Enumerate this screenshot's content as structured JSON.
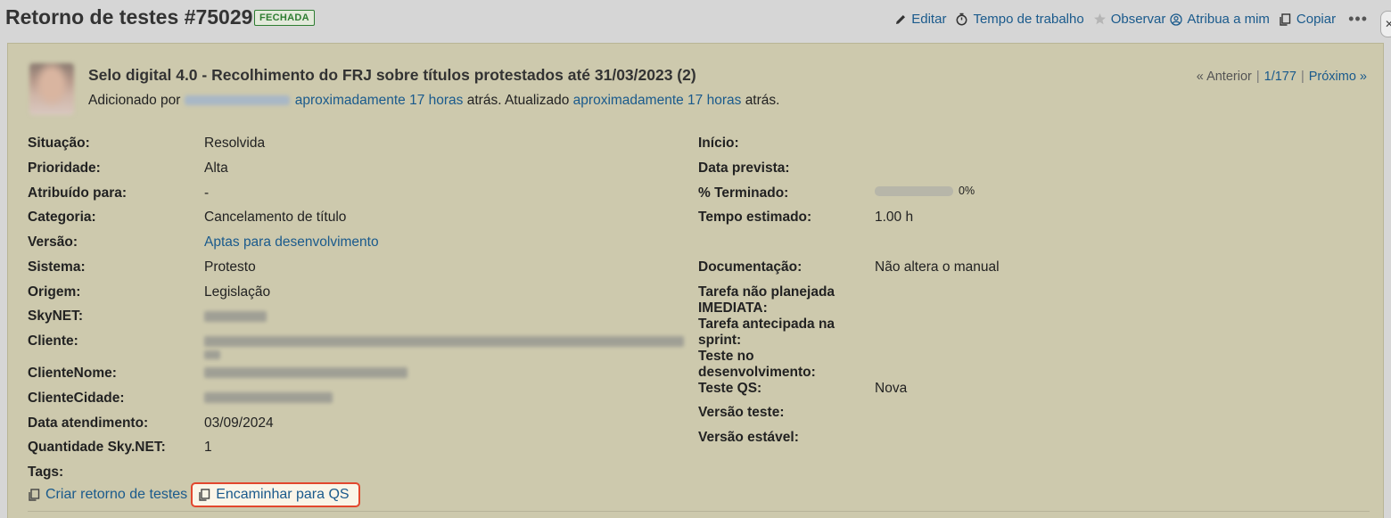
{
  "header": {
    "title": "Retorno de testes #75029",
    "status": "FECHADA",
    "actions": {
      "edit": "Editar",
      "time": "Tempo de trabalho",
      "watch": "Observar",
      "assign": "Atribua a mim",
      "copy": "Copiar"
    }
  },
  "issue": {
    "subject": "Selo digital 4.0 - Recolhimento do FRJ sobre títulos protestados até 31/03/2023 (2)",
    "added_by_prefix": "Adicionado por",
    "added_time": "aproximadamente 17 horas",
    "added_suffix": "atrás. Atualizado",
    "updated_time": "aproximadamente 17 horas",
    "updated_suffix": "atrás."
  },
  "nav": {
    "previous": "« Anterior",
    "position": "1/177",
    "next": "Próximo »"
  },
  "left_attrs": [
    {
      "label": "Situação:",
      "value": "Resolvida"
    },
    {
      "label": "Prioridade:",
      "value": "Alta"
    },
    {
      "label": "Atribuído para:",
      "value": "-"
    },
    {
      "label": "Categoria:",
      "value": "Cancelamento de título"
    },
    {
      "label": "Versão:",
      "value": "Aptas para desenvolvimento"
    },
    {
      "label": "Sistema:",
      "value": "Protesto"
    },
    {
      "label": "Origem:",
      "value": "Legislação"
    },
    {
      "label": "SkyNET:",
      "value": ""
    },
    {
      "label": "Cliente:",
      "value": ""
    },
    {
      "label": "ClienteNome:",
      "value": ""
    },
    {
      "label": "ClienteCidade:",
      "value": ""
    },
    {
      "label": "Data atendimento:",
      "value": "03/09/2024"
    },
    {
      "label": "Quantidade Sky.NET:",
      "value": "1"
    },
    {
      "label": "Tags:",
      "value": ""
    }
  ],
  "right_attrs": [
    {
      "label": "Início:",
      "value": ""
    },
    {
      "label": "Data prevista:",
      "value": ""
    },
    {
      "label": "% Terminado:",
      "value": "0%"
    },
    {
      "label": "Tempo estimado:",
      "value": "1.00 h"
    },
    {
      "label": "Documentação:",
      "value": "Não altera o manual"
    },
    {
      "label": "Tarefa não planejada IMEDIATA:",
      "value": ""
    },
    {
      "label": "Tarefa antecipada na sprint:",
      "value": ""
    },
    {
      "label": "Teste no desenvolvimento:",
      "value": ""
    },
    {
      "label": "Teste QS:",
      "value": "Nova"
    },
    {
      "label": "Versão teste:",
      "value": ""
    },
    {
      "label": "Versão estável:",
      "value": ""
    }
  ],
  "progress": {
    "percent": 0
  },
  "bottom_links": {
    "create": "Criar retorno de testes",
    "forward": "Encaminhar para QS"
  },
  "icons": [
    "pencil-icon",
    "stopwatch-icon",
    "star-icon",
    "user-circle-icon",
    "copy-icon",
    "more-icon"
  ]
}
